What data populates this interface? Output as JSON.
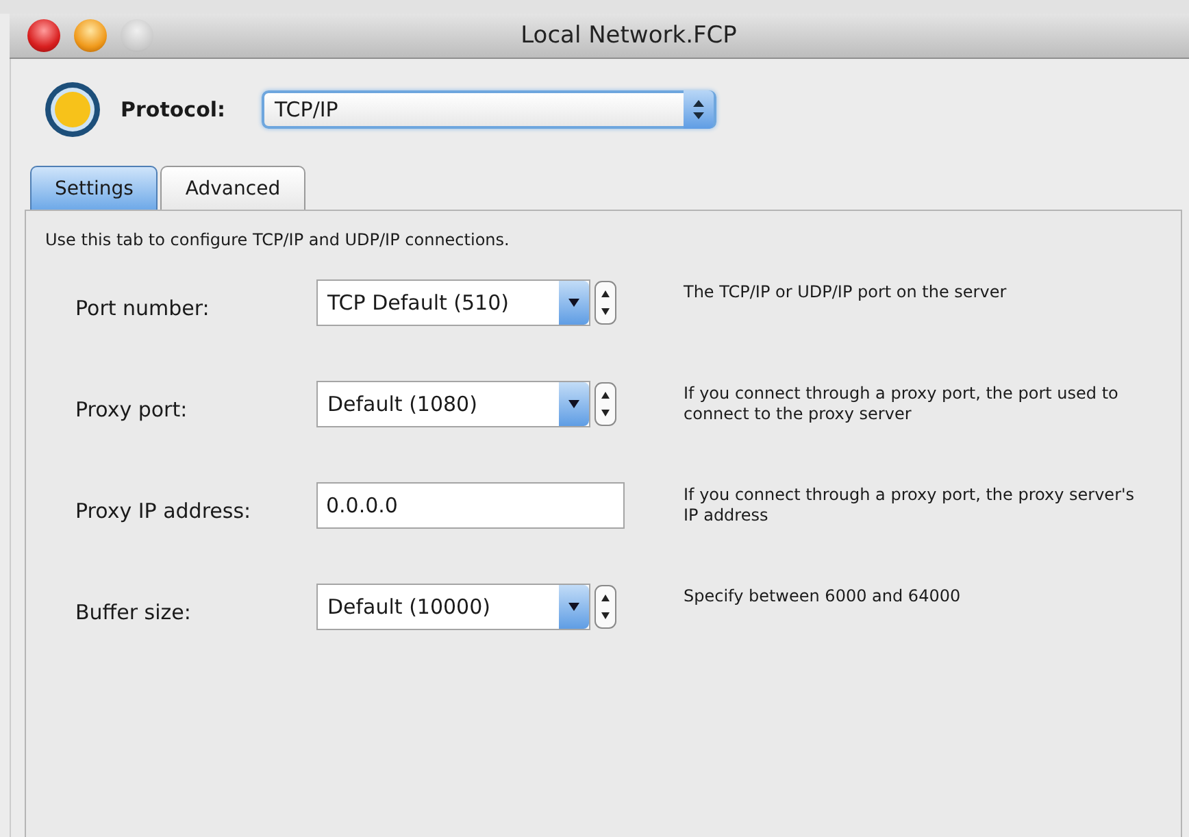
{
  "window": {
    "title": "Local Network.FCP"
  },
  "protocol": {
    "label": "Protocol:",
    "value": "TCP/IP"
  },
  "tabs": [
    {
      "label": "Settings",
      "selected": true
    },
    {
      "label": "Advanced",
      "selected": false
    }
  ],
  "panel": {
    "intro": "Use this tab to configure TCP/IP and UDP/IP connections.",
    "rows": [
      {
        "kind": "combo",
        "label": "Port number:",
        "value": "TCP Default (510)",
        "help": "The TCP/IP or UDP/IP port on the server"
      },
      {
        "kind": "combo",
        "label": "Proxy port:",
        "value": "Default (1080)",
        "help": "If you connect through a proxy port, the port used to connect to the proxy server"
      },
      {
        "kind": "text",
        "label": "Proxy IP address:",
        "value": "0.0.0.0",
        "help": "If you connect through a proxy port, the proxy server's IP address"
      },
      {
        "kind": "combo",
        "label": "Buffer size:",
        "value": "Default (10000)",
        "help": "Specify between 6000 and 64000"
      }
    ]
  }
}
